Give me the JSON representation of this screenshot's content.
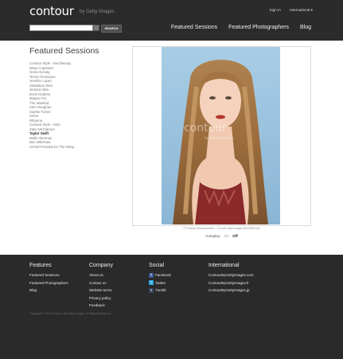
{
  "header": {
    "logo": "contour",
    "logo_sub": "by Getty Images",
    "top_links": [
      "Sign In",
      "International ▾"
    ],
    "search": {
      "value": "",
      "button": "SEARCH"
    },
    "nav": [
      "Featured Sessions",
      "Featured Photographers",
      "Blog"
    ]
  },
  "sidebar": {
    "title": "Featured Sessions",
    "sessions": [
      "Contour Style - Red Beauty",
      "Misty Copeland",
      "Greta Gerwig",
      "Tessa Thompson",
      "Jennifer Lopez",
      "Sebastian Stan",
      "Jessica Alba",
      "Doris Roberts",
      "Megan Fox",
      "The Weeknd",
      "Sam Heughan",
      "Sophie Turner",
      "Usher",
      "Rihanna",
      "Contour Style - H2O",
      "Zahn McClarnon",
      "Taylor Swift",
      "Malin Akerman",
      "Ben Whishaw",
      "SXSW Portraits for The Wrap"
    ],
    "active_index": 16
  },
  "photo": {
    "credit": "© Patrick Demarchelier / Conde Nast        Image #519204744",
    "watermark": "contour",
    "watermark_sub": "by Getty Images",
    "backdrop_color": "#9cc4de"
  },
  "autoplay": {
    "label": "Autoplay:",
    "on": "On",
    "off": "Off",
    "selected": "Off"
  },
  "footer": {
    "features": {
      "title": "Features",
      "links": [
        "Featured Sessions",
        "Featured Photographers",
        "Blog"
      ]
    },
    "company": {
      "title": "Company",
      "links": [
        "About us",
        "Contact us",
        "Website terms",
        "Privacy policy",
        "Feedback"
      ]
    },
    "social": {
      "title": "Social",
      "links": [
        {
          "label": "Facebook",
          "icon": "facebook-icon",
          "color": "#3b5998"
        },
        {
          "label": "Twitter",
          "icon": "twitter-icon",
          "color": "#29a9e1"
        },
        {
          "label": "Tumblr",
          "icon": "tumblr-icon",
          "color": "#35465c"
        }
      ]
    },
    "international": {
      "title": "International",
      "links": [
        "ContourByGettyImages.com",
        "ContourByGettyImages.fr",
        "ContourByGettyImages.jp"
      ]
    },
    "copyright": "Copyright © 2016 Contour by Getty Images. All Rights Reserved."
  }
}
